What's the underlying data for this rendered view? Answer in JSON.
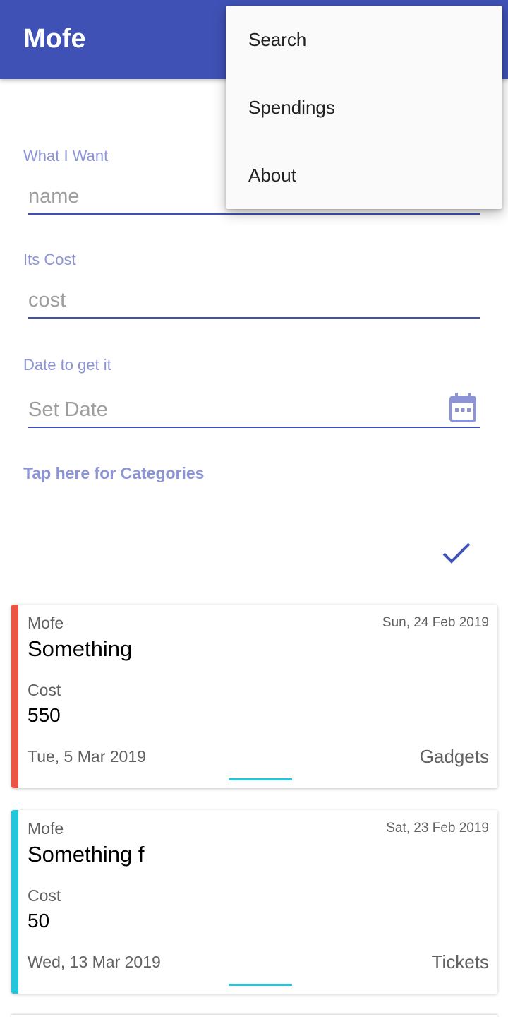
{
  "app": {
    "title": "Mofe",
    "accent": "#3f51b5"
  },
  "form": {
    "name_label": "What I Want",
    "name_placeholder": "name",
    "cost_label": "Its Cost",
    "cost_placeholder": "cost",
    "date_label": "Date to get it",
    "date_placeholder": "Set Date",
    "categories_link": "Tap here for Categories"
  },
  "icons": {
    "calendar": "calendar-icon",
    "check": "check-icon"
  },
  "menu": {
    "items": [
      {
        "label": "Search"
      },
      {
        "label": "Spendings"
      },
      {
        "label": "About"
      }
    ]
  },
  "cards": [
    {
      "owner": "Mofe",
      "created": "Sun, 24 Feb 2019",
      "name": "Something",
      "cost_label": "Cost",
      "cost": "550",
      "target_date": "Tue, 5 Mar 2019",
      "category": "Gadgets",
      "stripe_color": "#ea5545"
    },
    {
      "owner": "Mofe",
      "created": "Sat, 23 Feb 2019",
      "name": "Something f",
      "cost_label": "Cost",
      "cost": "50",
      "target_date": "Wed, 13 Mar 2019",
      "category": "Tickets",
      "stripe_color": "#26c6da"
    }
  ]
}
